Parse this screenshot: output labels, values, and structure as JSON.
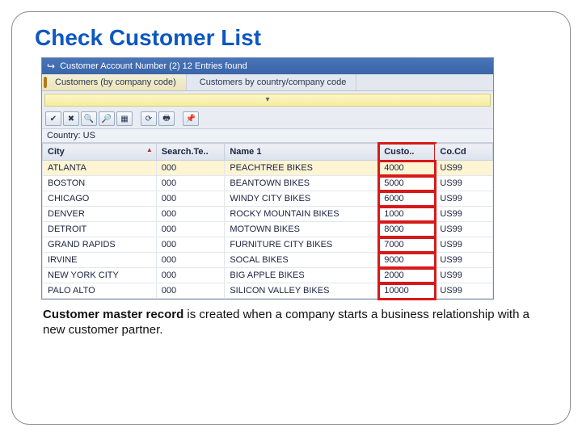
{
  "slide": {
    "title": "Check Customer List",
    "caption_bold": "Customer master record",
    "caption_rest": " is created when a company starts a business relationship with a new customer partner."
  },
  "sap": {
    "titlebar": "Customer Account Number (2)   12 Entries found",
    "tabs": {
      "active": "Customers (by company code)",
      "inactive": "Customers by country/company code"
    },
    "filter_dropdown": "▾",
    "country_label": "Country: US",
    "columns": {
      "city": "City",
      "search": "Search.Te..",
      "name": "Name 1",
      "cust": "Custo..",
      "cocd": "Co.Cd"
    },
    "rows": [
      {
        "city": "ATLANTA",
        "search": "000",
        "name": "PEACHTREE BIKES",
        "cust": "4000",
        "cocd": "US99"
      },
      {
        "city": "BOSTON",
        "search": "000",
        "name": "BEANTOWN BIKES",
        "cust": "5000",
        "cocd": "US99"
      },
      {
        "city": "CHICAGO",
        "search": "000",
        "name": "WINDY CITY BIKES",
        "cust": "6000",
        "cocd": "US99"
      },
      {
        "city": "DENVER",
        "search": "000",
        "name": "ROCKY MOUNTAIN BIKES",
        "cust": "1000",
        "cocd": "US99"
      },
      {
        "city": "DETROIT",
        "search": "000",
        "name": "MOTOWN BIKES",
        "cust": "8000",
        "cocd": "US99"
      },
      {
        "city": "GRAND RAPIDS",
        "search": "000",
        "name": "FURNITURE CITY BIKES",
        "cust": "7000",
        "cocd": "US99"
      },
      {
        "city": "IRVINE",
        "search": "000",
        "name": "SOCAL BIKES",
        "cust": "9000",
        "cocd": "US99"
      },
      {
        "city": "NEW YORK CITY",
        "search": "000",
        "name": "BIG APPLE BIKES",
        "cust": "2000",
        "cocd": "US99"
      },
      {
        "city": "PALO ALTO",
        "search": "000",
        "name": "SILICON VALLEY BIKES",
        "cust": "10000",
        "cocd": "US99"
      }
    ],
    "toolbar_icons": [
      "✔",
      "✖",
      "🔍",
      "🔎",
      "▦",
      "⟳",
      "🖶",
      "",
      "📌"
    ]
  }
}
